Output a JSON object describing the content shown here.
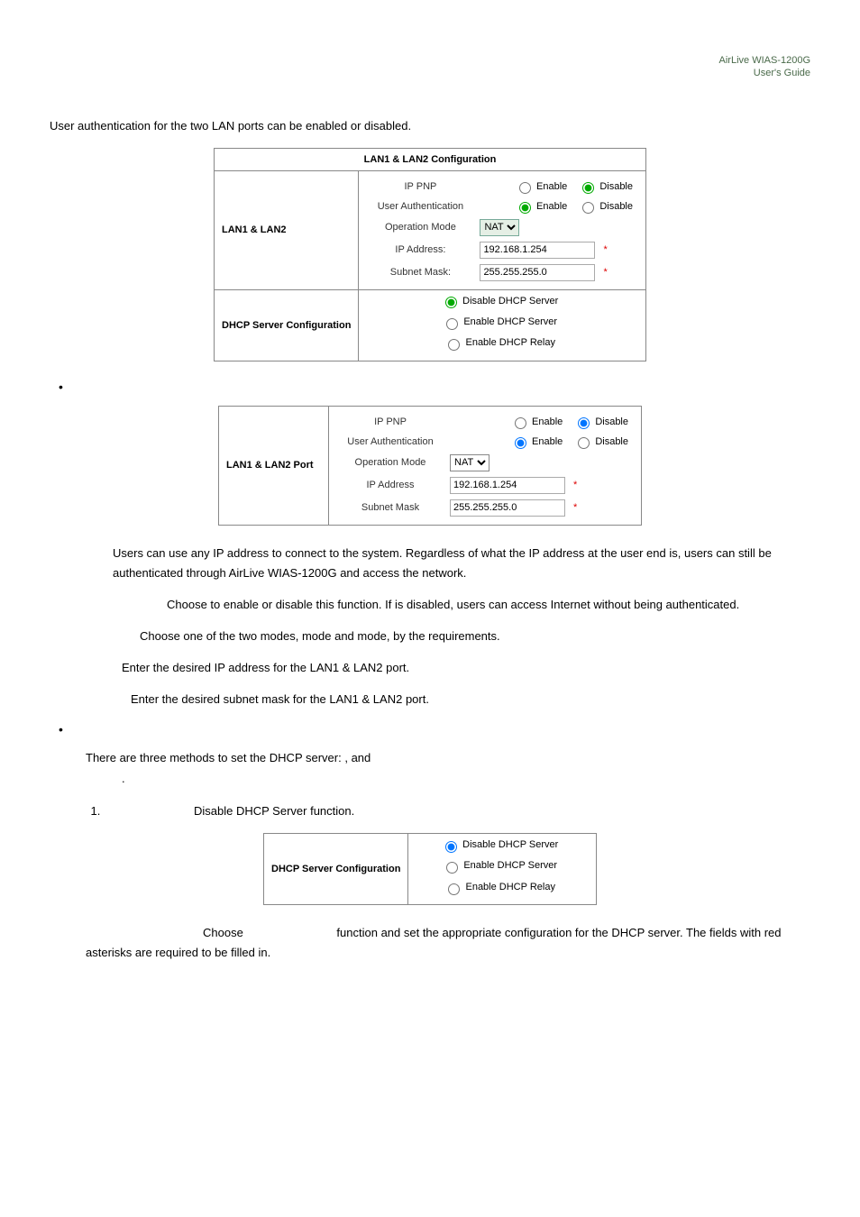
{
  "header": {
    "line1": "AirLive WIAS-1200G",
    "line2": "User's Guide"
  },
  "intro": "User authentication for the two LAN ports can be enabled or disabled.",
  "table1": {
    "title": "LAN1 & LAN2 Configuration",
    "row1_label": "LAN1 & LAN2",
    "ip_pnp": "IP PNP",
    "enable": "Enable",
    "disable": "Disable",
    "user_auth": "User Authentication",
    "op_mode": "Operation Mode",
    "nat": "NAT",
    "ip_addr_label": "IP Address:",
    "ip_addr_value": "192.168.1.254",
    "subnet_label": "Subnet Mask:",
    "subnet_value": "255.255.255.0",
    "dhcp_label": "DHCP Server Configuration",
    "dhcp_disable": "Disable DHCP Server",
    "dhcp_enable": "Enable DHCP Server",
    "dhcp_relay": "Enable DHCP Relay"
  },
  "table2": {
    "row_label": "LAN1 & LAN2 Port",
    "ip_pnp": "IP PNP",
    "enable": "Enable",
    "disable": "Disable",
    "user_auth": "User Authentication",
    "op_mode": "Operation Mode",
    "nat": "NAT",
    "ip_addr_label": "IP Address",
    "ip_addr_value": "192.168.1.254",
    "subnet_label": "Subnet Mask",
    "subnet_value": "255.255.255.0"
  },
  "paragraphs": {
    "p1": "Users can use any IP address to connect to the system. Regardless of what the IP address at the user end is, users can still be authenticated through AirLive WIAS-1200G and access the network.",
    "p2a": "Choose to enable or disable this function. If ",
    "p2b": " is disabled, users can access Internet without being authenticated.",
    "p3a": "Choose one of the two modes, ",
    "p3b": " mode and ",
    "p3c": " mode, by the requirements.",
    "p4": "Enter the desired IP address for the LAN1 & LAN2 port.",
    "p5": "Enter the desired subnet mask for the LAN1 & LAN2 port.",
    "dhcp_intro_a": "There are three methods to set the DHCP server: ",
    "dhcp_intro_b": ", ",
    "dhcp_intro_c": " and ",
    "dhcp_intro_d": ".",
    "num1": "Disable DHCP Server function.",
    "num2a": "Choose ",
    "num2b": " function and set the appropriate configuration for the DHCP server. The fields with red asterisks are required to be filled in."
  },
  "dhcp_small": {
    "label": "DHCP Server Configuration",
    "opt1": "Disable DHCP Server",
    "opt2": "Enable DHCP Server",
    "opt3": "Enable DHCP Relay"
  }
}
